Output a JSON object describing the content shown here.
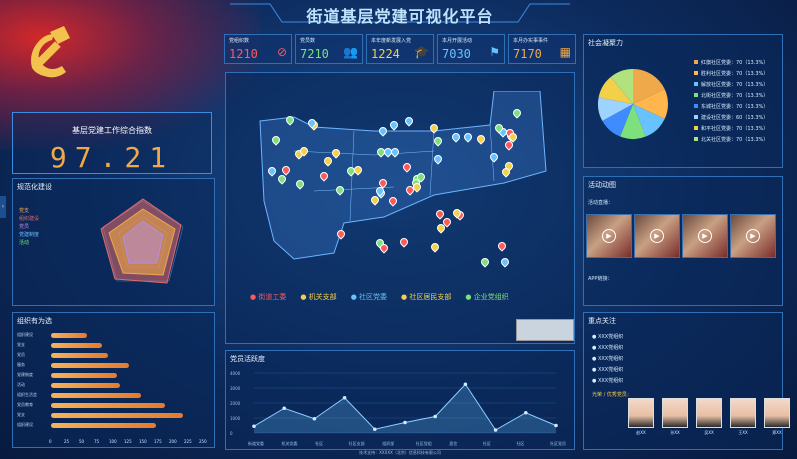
{
  "title": "街道基层党建可视化平台",
  "kpis": [
    {
      "label": "党组织数",
      "value": "1210",
      "color": "#ff5a5a",
      "icon": "no-symbol-icon"
    },
    {
      "label": "党员数",
      "value": "7210",
      "color": "#7de07d",
      "icon": "people-icon"
    },
    {
      "label": "本年度新发展入党",
      "value": "1224",
      "color": "#f3d04a",
      "icon": "graduation-cap-icon"
    },
    {
      "label": "本月开展活动",
      "value": "7030",
      "color": "#67c2ff",
      "icon": "flag-icon"
    },
    {
      "label": "本月办实事事件",
      "value": "7170",
      "color": "#f0a94a",
      "icon": "calendar-icon"
    }
  ],
  "index": {
    "title": "基层党建工作综合指数",
    "value": "97.21"
  },
  "standard": {
    "title": "规范化建设",
    "legend": [
      "党支",
      "组织建设",
      "党员",
      "党建制度",
      "活动"
    ]
  },
  "organization": {
    "title": "组织有为选",
    "rows": [
      {
        "label": "组织建设",
        "value": 60
      },
      {
        "label": "党支",
        "value": 85
      },
      {
        "label": "党员",
        "value": 95
      },
      {
        "label": "服务",
        "value": 130
      },
      {
        "label": "党建制度",
        "value": 110
      },
      {
        "label": "活动",
        "value": 115
      },
      {
        "label": "组织生活会",
        "value": 150
      },
      {
        "label": "党员教育",
        "value": 190
      },
      {
        "label": "党支",
        "value": 220
      },
      {
        "label": "组织建设",
        "value": 175
      }
    ],
    "axis": [
      "0",
      "25",
      "50",
      "75",
      "100",
      "125",
      "150",
      "175",
      "200",
      "225",
      "250"
    ]
  },
  "map_legend": [
    {
      "label": "街道工委",
      "color": "#ff5a5a"
    },
    {
      "label": "机关支部",
      "color": "#f3d04a"
    },
    {
      "label": "社区党委",
      "color": "#67c2ff"
    },
    {
      "label": "社区居民支部",
      "color": "#f3d04a"
    },
    {
      "label": "企业党组织",
      "color": "#7de07d"
    }
  ],
  "activity": {
    "title": "党员活跃度",
    "categories": [
      "街道党委",
      "机关党委",
      "社区",
      "社区支部",
      "组织部",
      "社区党组",
      "居住",
      "社区",
      "社区",
      "社区党员"
    ],
    "values": [
      450,
      1650,
      950,
      2350,
      250,
      700,
      1100,
      3250,
      200,
      1350,
      500
    ],
    "ylim": [
      0,
      4000
    ],
    "yticks": [
      "4000",
      "3000",
      "2000",
      "1000",
      "0"
    ]
  },
  "cohesion": {
    "title": "社会凝聚力",
    "items": [
      {
        "label": "红旗社区党委：70（13.3%）",
        "color": "#f0a94a"
      },
      {
        "label": "胜利社区党委：70（13.3%）",
        "color": "#ffb74d"
      },
      {
        "label": "解放社区党委：70（13.3%）",
        "color": "#67c2ff"
      },
      {
        "label": "北街社区党委：70（13.3%）",
        "color": "#7de07d"
      },
      {
        "label": "东城社区党委：70（13.3%）",
        "color": "#3f8cff"
      },
      {
        "label": "建设社区党委：60（13.3%）",
        "color": "#9fd3ff"
      },
      {
        "label": "和平社区党委：70（13.3%）",
        "color": "#f3d04a"
      },
      {
        "label": "北关社区党委：70（13.3%）",
        "color": "#b1e27d"
      }
    ],
    "slices": [
      18,
      14,
      12,
      12,
      11,
      11,
      11,
      11
    ]
  },
  "live": {
    "title": "活动动图",
    "live_label": "活动直播：",
    "app_label": "APP链接："
  },
  "focus": {
    "title": "重点关注",
    "items": [
      "XXX党组织",
      "XXX党组织",
      "XXX党组织",
      "XXX党组织",
      "XXX党组织"
    ],
    "sub": "光荣 / 优秀党员：",
    "people": [
      "赵XX",
      "孙XX",
      "吴XX",
      "王XX",
      "郑XX"
    ]
  },
  "footer": "技术支持：XXXXX（北京）信息科技有限公司"
}
